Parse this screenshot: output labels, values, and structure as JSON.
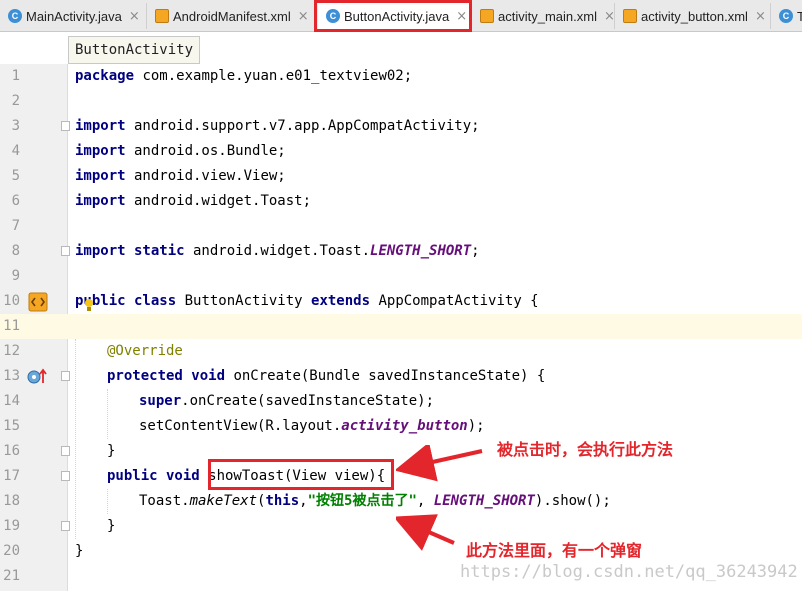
{
  "tabs": [
    {
      "label": "MainActivity.java",
      "type": "java",
      "active": false
    },
    {
      "label": "AndroidManifest.xml",
      "type": "xml",
      "active": false
    },
    {
      "label": "ButtonActivity.java",
      "type": "java",
      "active": true
    },
    {
      "label": "activity_main.xml",
      "type": "xml",
      "active": false
    },
    {
      "label": "activity_button.xml",
      "type": "xml",
      "active": false
    },
    {
      "label": "T",
      "type": "java",
      "active": false
    }
  ],
  "tab_close_glyph": "×",
  "tooltip": "ButtonActivity",
  "line_numbers": [
    "1",
    "2",
    "3",
    "4",
    "5",
    "6",
    "7",
    "8",
    "9",
    "10",
    "11",
    "12",
    "13",
    "14",
    "15",
    "16",
    "17",
    "18",
    "19",
    "20",
    "21"
  ],
  "code": {
    "l1": {
      "kw": "package",
      "rest": " com.example.yuan.e01_textview02;"
    },
    "l3": {
      "kw": "import",
      "rest": " android.support.v7.app.AppCompatActivity;"
    },
    "l4": {
      "kw": "import",
      "rest": " android.os.Bundle;"
    },
    "l5": {
      "kw": "import",
      "rest": " android.view.View;"
    },
    "l6": {
      "kw": "import",
      "rest": " android.widget.Toast;"
    },
    "l8": {
      "kw": "import static",
      "rest": " android.widget.Toast.",
      "field": "LENGTH_SHORT",
      "end": ";"
    },
    "l10": {
      "kw1": "public class",
      "name": " ButtonActivity ",
      "kw2": "extends",
      "rest": " AppCompatActivity {"
    },
    "l12": {
      "annotation": "@Override"
    },
    "l13": {
      "kw": "protected void",
      "rest": " onCreate(Bundle savedInstanceState) {"
    },
    "l14": {
      "kw": "super",
      "rest": ".onCreate(savedInstanceState);"
    },
    "l15": {
      "pre": "setContentView(R.layout.",
      "field": "activity_button",
      "end": ");"
    },
    "l16": {
      "text": "}"
    },
    "l17": {
      "kw": "public void",
      "sig": " showToast(View view){"
    },
    "l18": {
      "pre": "Toast.",
      "method": "makeText",
      "open": "(",
      "kw": "this",
      "comma": ",",
      "str": "\"按钮5被点击了\"",
      "sep": ", ",
      "field": "LENGTH_SHORT",
      "end": ").show();"
    },
    "l19": {
      "text": "}"
    },
    "l20": {
      "text": "}"
    }
  },
  "callouts": {
    "method_called": "被点击时，会执行此方法",
    "popup": "此方法里面，有一个弹窗"
  },
  "watermark": "https://blog.csdn.net/qq_36243942",
  "colors": {
    "highlight": "#e3262c",
    "keyword": "#000080",
    "string": "#008000",
    "static_field": "#660e7a",
    "annotation": "#808000"
  }
}
